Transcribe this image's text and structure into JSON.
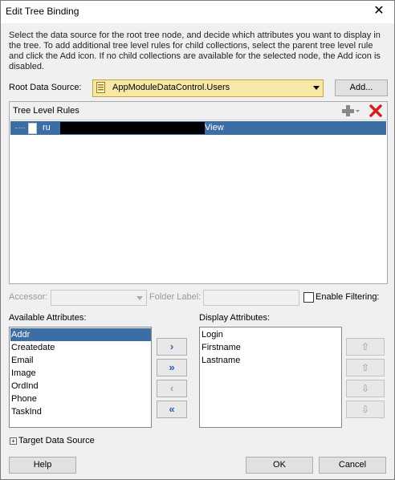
{
  "window": {
    "title": "Edit Tree Binding",
    "close_glyph": "✕"
  },
  "description": "Select the data source for the root tree node, and decide which attributes you want to display in the tree. To add additional tree level rules for child collections, select the parent tree level rule and click the Add icon. If no child collections are available for the selected node, the Add icon is disabled.",
  "root_data_source": {
    "label": "Root Data Source:",
    "value": "AppModuleDataControl.Users",
    "add_button": "Add..."
  },
  "tree_level_rules": {
    "title": "Tree Level Rules",
    "add_icon": "plus-icon",
    "delete_icon": "red-x-icon",
    "selected_rule": {
      "prefix": "ru",
      "suffix": "View"
    }
  },
  "rule_options": {
    "accessor_label": "Accessor:",
    "folder_label": "Folder Label:",
    "enable_filtering_label": "Enable Filtering:"
  },
  "available_attributes": {
    "label": "Available Attributes:",
    "items": [
      "Addr",
      "Createdate",
      "Email",
      "Image",
      "OrdInd",
      "Phone",
      "TaskInd"
    ],
    "selected": "Addr"
  },
  "display_attributes": {
    "label": "Display Attributes:",
    "items": [
      "Login",
      "Firstname",
      "Lastname"
    ]
  },
  "shuttle": {
    "move": "›",
    "move_all": "»",
    "remove": "‹",
    "remove_all": "«"
  },
  "ordering": {
    "top": "⇧",
    "up": "⇧",
    "down": "⇩",
    "bottom": "⇩"
  },
  "target_data_source": {
    "label": "Target Data Source",
    "expander": "+"
  },
  "footer": {
    "help": "Help",
    "ok": "OK",
    "cancel": "Cancel"
  },
  "colors": {
    "selection": "#3c6ea5",
    "combo_bg": "#f7e8a6",
    "delete": "#d42020"
  }
}
